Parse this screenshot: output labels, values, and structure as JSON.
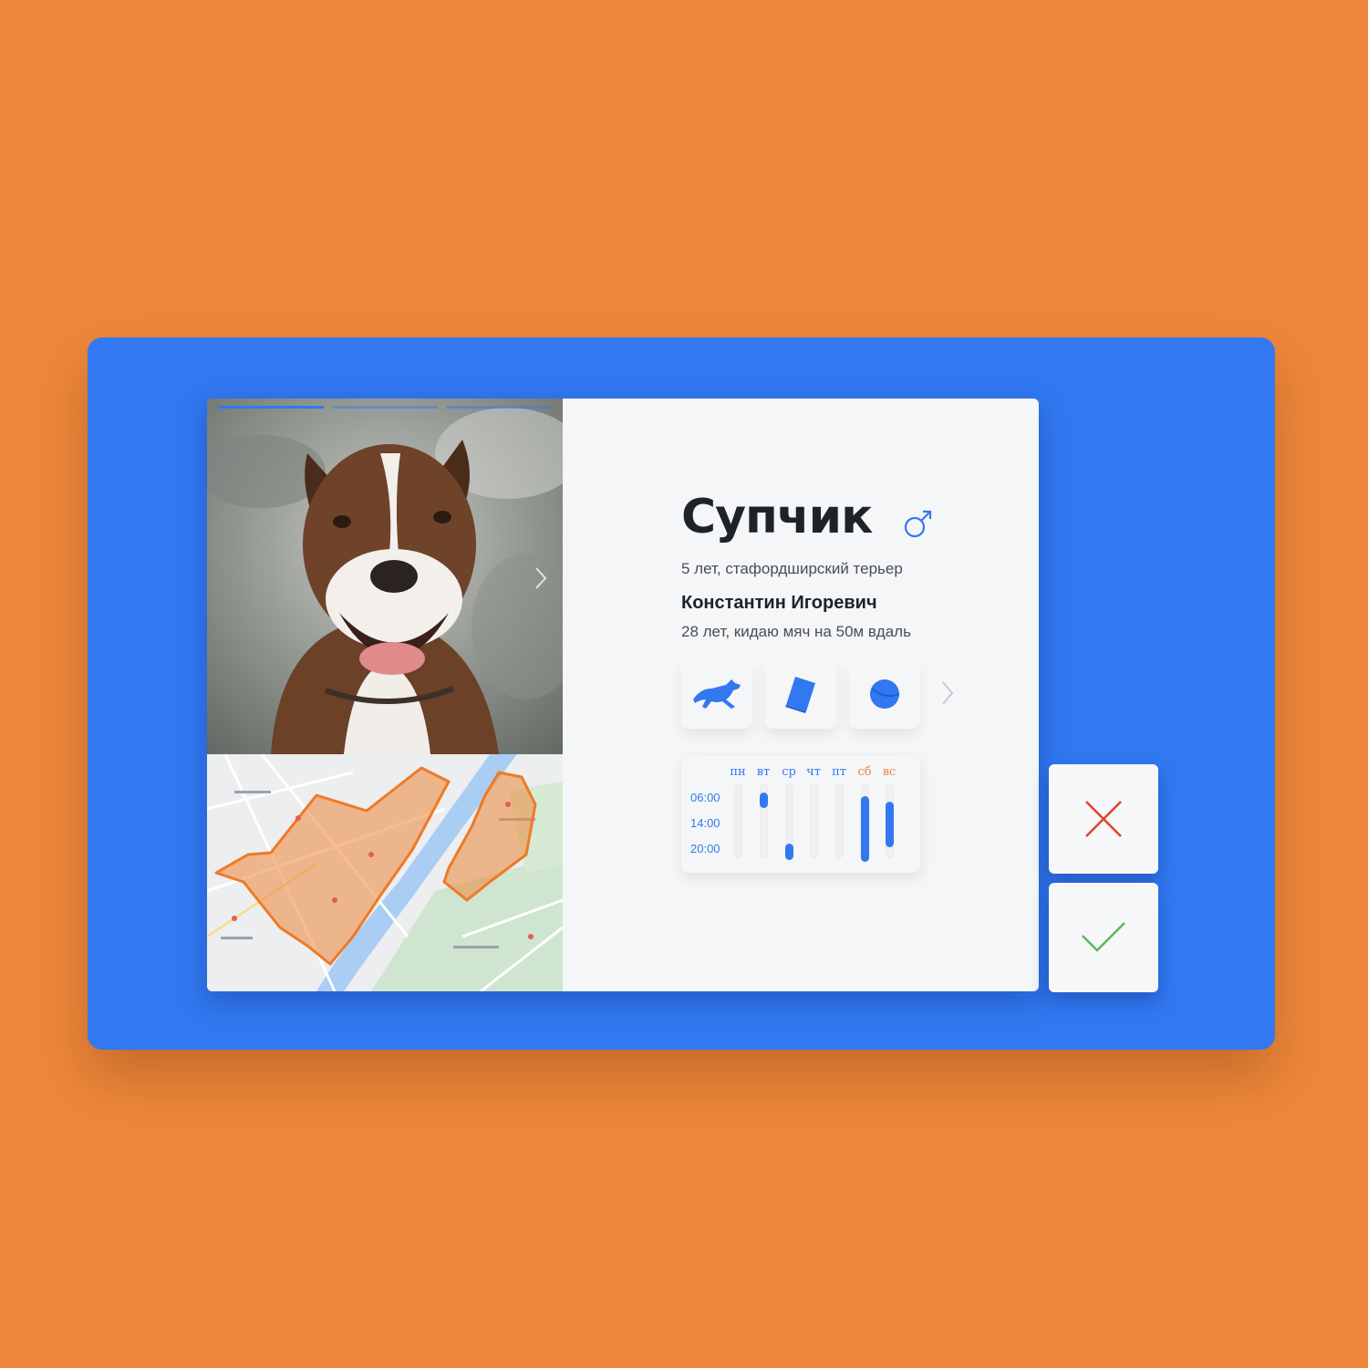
{
  "profile": {
    "pet_name": "Супчик",
    "gender": "male",
    "pet_description": "5 лет, стафордширский терьер",
    "owner_name": "Константин Игоревич",
    "owner_description": "28 лет, кидаю мяч на 50м вдаль"
  },
  "photo": {
    "count": 3,
    "current": 1
  },
  "activities": [
    {
      "icon": "running-dog-icon"
    },
    {
      "icon": "book-icon"
    },
    {
      "icon": "ball-icon"
    }
  ],
  "schedule": {
    "days": [
      "пн",
      "вт",
      "ср",
      "чт",
      "пт",
      "сб",
      "вс"
    ],
    "times": [
      "06:00",
      "14:00",
      "20:00"
    ]
  },
  "actions": {
    "reject_icon": "close-icon",
    "accept_icon": "check-icon"
  },
  "colors": {
    "accent": "#3278f0",
    "background": "#ee873b",
    "reject": "#e0452c",
    "accept": "#5cb85c",
    "zone": "#ee873b"
  }
}
